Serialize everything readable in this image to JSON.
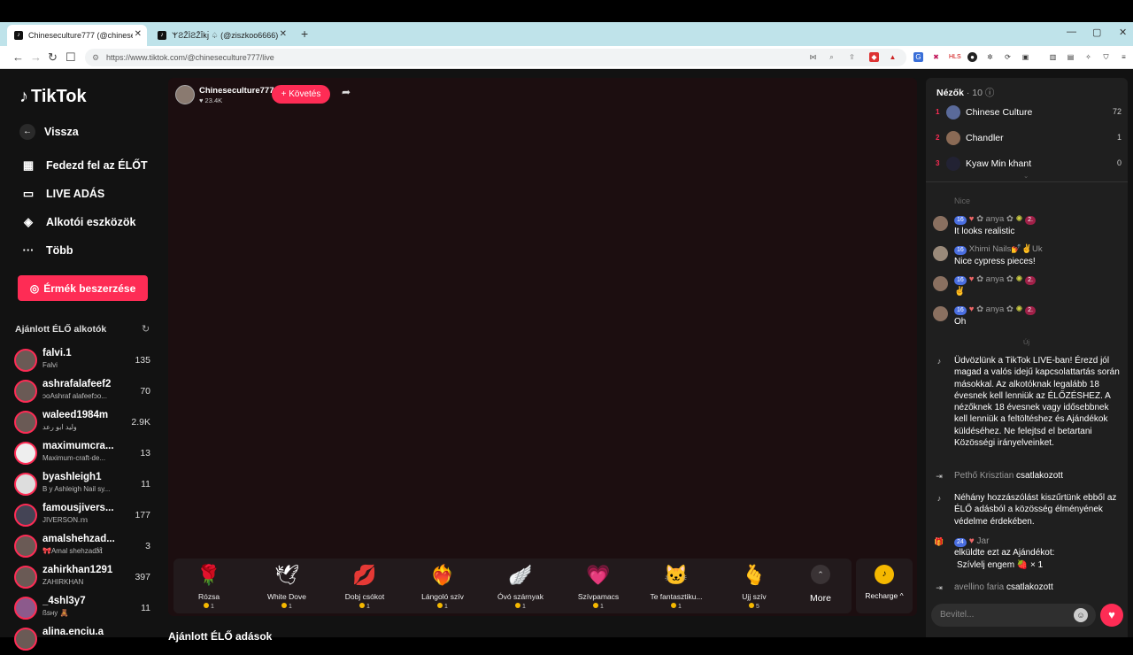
{
  "browser": {
    "tabs": [
      {
        "title": "Chineseculture777 (@chineseculture777)"
      },
      {
        "title": "𐌙ƧŽÌƧŽÎ𐌺ȷ̀ ♤ (@ziszkoo6666) ÉLŐ"
      }
    ],
    "new_tab": "+",
    "url": "https://www.tiktok.com/@chineseculture777/live",
    "window_controls": [
      "—",
      "▢",
      "✕"
    ]
  },
  "sidebar": {
    "logo": "TikTok",
    "back": "Vissza",
    "nav": [
      {
        "label": "Fedezd fel az ÉLŐT",
        "icon": "calendar-live-icon"
      },
      {
        "label": "LIVE ADÁS",
        "icon": "camera-icon"
      },
      {
        "label": "Alkotói eszközök",
        "icon": "creator-tools-icon"
      },
      {
        "label": "Több",
        "icon": "more-icon"
      }
    ],
    "coins_button": "Érmék beszerzése",
    "suggested_title": "Ajánlott ÉLŐ alkotók",
    "creators": [
      {
        "name": "falvi.1",
        "sub": "Falvi",
        "count": "135"
      },
      {
        "name": "ashrafalafeef2",
        "sub": "ↄoAshraf alafeefↄo...",
        "count": "70"
      },
      {
        "name": "waleed1984m",
        "sub": "وليد ابو رعد",
        "count": "2.9K"
      },
      {
        "name": "maximumcra...",
        "sub": "Maximum-craft-de...",
        "count": "13"
      },
      {
        "name": "byashleigh1",
        "sub": "B y Ashleigh Nail sy...",
        "count": "11"
      },
      {
        "name": "famousjivers...",
        "sub": "JIVERSON.𝕞",
        "count": "177"
      },
      {
        "name": "amalshehzad...",
        "sub": "🎀Amal shehzad🕅",
        "count": "3"
      },
      {
        "name": "zahirkhan1291",
        "sub": "ZAHIRKHAN",
        "count": "397"
      },
      {
        "name": "_4shl3y7",
        "sub": "ßsнy 🧸",
        "count": "11"
      },
      {
        "name": "alina.enciu.a",
        "sub": "",
        "count": ""
      }
    ]
  },
  "stream": {
    "host_name": "Chineseculture777",
    "host_likes": "23.4K",
    "follow": "+ Követés",
    "gifts": [
      {
        "name": "Rózsa",
        "price": "1",
        "icon": "🌹"
      },
      {
        "name": "White Dove",
        "price": "1",
        "icon": "🕊"
      },
      {
        "name": "Dobj csókot",
        "price": "1",
        "icon": "💋"
      },
      {
        "name": "Lángoló szív",
        "price": "1",
        "icon": "❤️‍🔥"
      },
      {
        "name": "Óvó szárnyak",
        "price": "1",
        "icon": "🪽"
      },
      {
        "name": "Szívpamacs",
        "price": "1",
        "icon": "💗"
      },
      {
        "name": "Te fantasztiku...",
        "price": "1",
        "icon": "🐱"
      },
      {
        "name": "Ujj szív",
        "price": "5",
        "icon": "🫰"
      }
    ],
    "more": "More",
    "recharge": "Recharge ^",
    "below_title": "Ajánlott ÉLŐ adások"
  },
  "chat": {
    "viewers_label": "Nézők",
    "viewers_count": "· 10",
    "viewers": [
      {
        "rank": "1",
        "name": "Chinese Culture",
        "score": "72"
      },
      {
        "rank": "2",
        "name": "Chandler",
        "score": "1"
      },
      {
        "rank": "3",
        "name": "Kyaw Min khant",
        "score": "0"
      }
    ],
    "faded_msg": "Nice",
    "messages": [
      {
        "level": "16",
        "user": "✿ anya ✿",
        "text": "It looks realistic",
        "rank": "2."
      },
      {
        "level": "16",
        "user": "Xhimi Nails💅✌Uk",
        "text": "Nice cypress pieces!",
        "rank": ""
      },
      {
        "level": "16",
        "user": "✿ anya ✿",
        "text": "✌",
        "rank": "2."
      },
      {
        "level": "16",
        "user": "✿ anya ✿",
        "text": "Oh",
        "rank": "2."
      }
    ],
    "new_divider": "Új",
    "welcome": "Üdvözlünk a TikTok LIVE-ban! Érezd jól magad a valós idejű kapcsolattartás során másokkal. Az alkotóknak legalább 18 évesnek kell lenniük az ÉLŐZÉSHEZ. A nézőknek 18 évesnek vagy idősebbnek kell lenniük a feltöltéshez és Ajándékok küldéséhez. Ne felejtsd el betartani Közösségi irányelveinket.",
    "join1_user": "Pethő Krisztian",
    "join_label": "csatlakozott",
    "filter_notice": "Néhány hozzászólást kiszűrtünk ebből az ÉLŐ adásból a közösség élményének védelme érdekében.",
    "gift_level": "24",
    "gift_user": "Jar",
    "gift_line1": "elküldte ezt az Ajándékot:",
    "gift_line2": "Szívlelj engem 🍓 × 1",
    "join2_user": "avellino faria",
    "input_placeholder": "Bevitel..."
  }
}
